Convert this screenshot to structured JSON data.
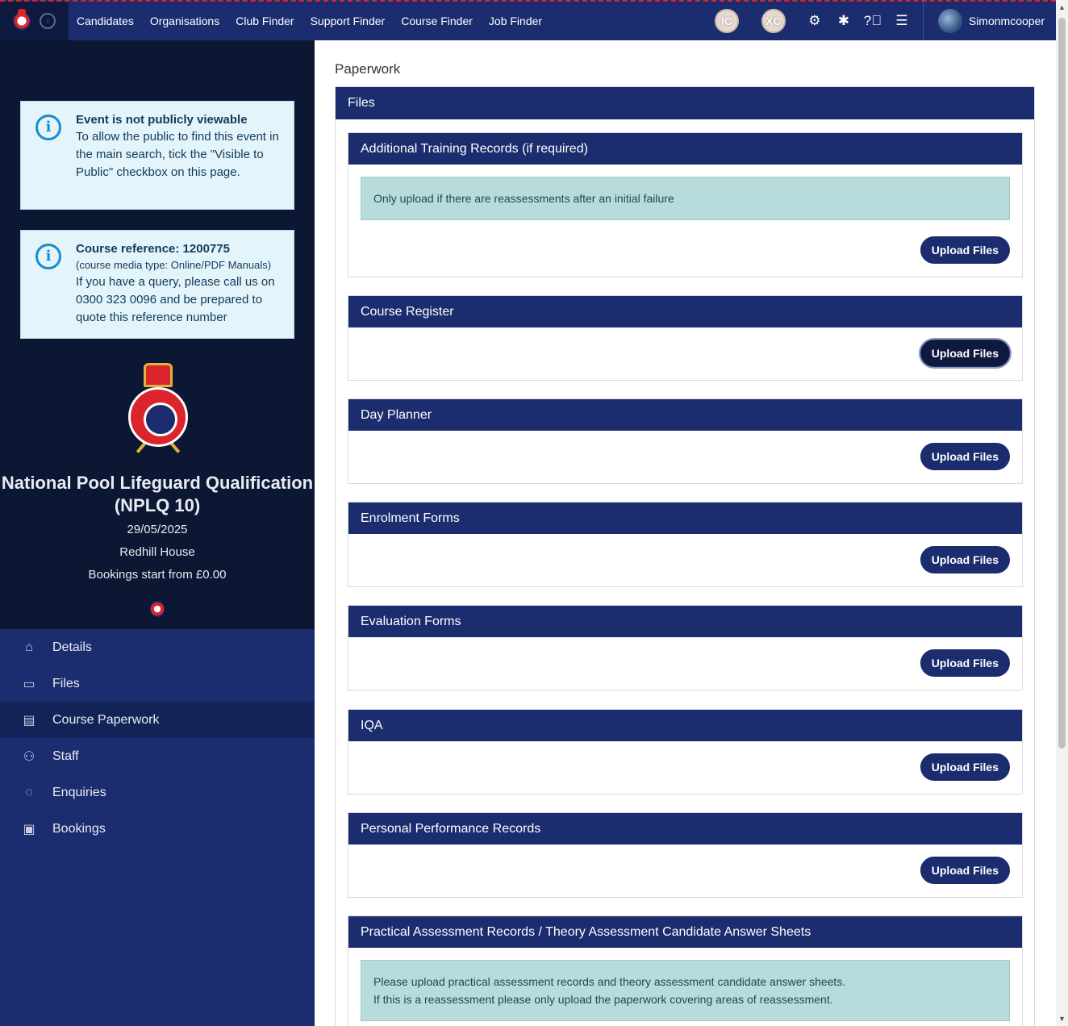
{
  "topnav": {
    "links": [
      "Candidates",
      "Organisations",
      "Club Finder",
      "Support Finder",
      "Course Finder",
      "Job Finder"
    ],
    "badges": [
      "IC",
      "XC"
    ],
    "icons": [
      "gear-icon",
      "bug-icon",
      "help-icon",
      "menu-icon"
    ],
    "user_name": "Simonmcooper"
  },
  "sidebar": {
    "notice1": {
      "title": "Event is not publicly viewable",
      "body": "To allow the public to find this event in the main search, tick the \"Visible to Public\" checkbox on this page."
    },
    "notice2": {
      "title": "Course reference: 1200775",
      "media": "(course media type: Online/PDF Manuals)",
      "body": "If you have a query, please call us on 0300 323 0096 and be prepared to quote this reference number"
    },
    "course": {
      "title": "National Pool Lifeguard Qualification (NPLQ 10)",
      "date": "29/05/2025",
      "venue": "Redhill House",
      "price": "Bookings start from £0.00"
    },
    "menu": [
      {
        "label": "Details",
        "icon": "home-icon"
      },
      {
        "label": "Files",
        "icon": "folder-icon"
      },
      {
        "label": "Course Paperwork",
        "icon": "document-icon"
      },
      {
        "label": "Staff",
        "icon": "users-icon"
      },
      {
        "label": "Enquiries",
        "icon": "chat-icon"
      },
      {
        "label": "Bookings",
        "icon": "clipboard-icon"
      }
    ],
    "active_item": "Course Paperwork"
  },
  "main": {
    "page_title": "Paperwork",
    "files_header": "Files",
    "upload_label": "Upload Files",
    "sections": [
      {
        "title": "Additional Training Records (if required)",
        "notice": "Only upload if there are reassessments after an initial failure"
      },
      {
        "title": "Course Register"
      },
      {
        "title": "Day Planner"
      },
      {
        "title": "Enrolment Forms"
      },
      {
        "title": "Evaluation Forms"
      },
      {
        "title": "IQA"
      },
      {
        "title": "Personal Performance Records"
      },
      {
        "title": "Practical Assessment Records / Theory Assessment Candidate Answer Sheets",
        "notice_lines": [
          "Please upload practical assessment records and theory assessment candidate answer sheets.",
          "If this is a reassessment please only upload the paperwork covering areas of reassessment."
        ]
      }
    ]
  },
  "colors": {
    "navy": "#1b2d6e",
    "dark_navy": "#0b1733",
    "notice_teal": "#b8dcdc",
    "info_bg": "#e4f4fb",
    "red_accent": "#d9252b"
  }
}
